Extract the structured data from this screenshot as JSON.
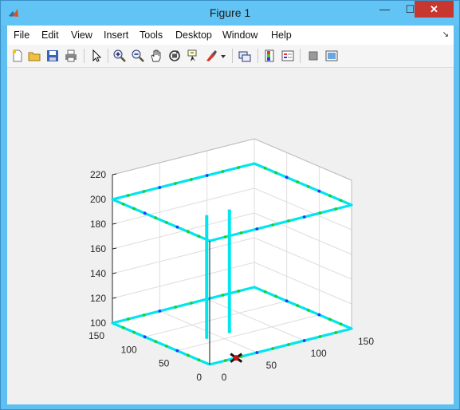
{
  "window": {
    "title": "Figure 1",
    "min_label": "—",
    "max_label": "☐",
    "close_label": "✕"
  },
  "menu": {
    "items": [
      "File",
      "Edit",
      "View",
      "Insert",
      "Tools",
      "Desktop",
      "Window",
      "Help"
    ],
    "overflow_arrow": "↘"
  },
  "toolbar": {
    "icons": [
      "new-figure-icon",
      "open-file-icon",
      "save-icon",
      "print-icon",
      "pointer-icon",
      "zoom-in-icon",
      "zoom-out-icon",
      "pan-icon",
      "rotate-3d-icon",
      "data-cursor-icon",
      "brush-icon",
      "brush-dropdown-icon",
      "link-plot-icon",
      "colorbar-icon",
      "legend-icon",
      "hide-plot-tools-icon",
      "show-plot-tools-icon"
    ]
  },
  "chart_data": {
    "type": "line3d",
    "title": "",
    "z_ticks": [
      "100",
      "120",
      "140",
      "160",
      "180",
      "200",
      "220"
    ],
    "y_ticks": [
      "0",
      "50",
      "100",
      "150"
    ],
    "x_ticks": [
      "0",
      "50",
      "100",
      "150"
    ],
    "zlim": [
      100,
      220
    ],
    "xlim": [
      0,
      150
    ],
    "ylim": [
      0,
      150
    ],
    "grid": true,
    "colors": {
      "path": "#00e5ee",
      "markers_green": "#22cc22",
      "markers_blue": "#1a3cff",
      "connector": "#111111",
      "start_marker": "#cc1111"
    },
    "series": [
      {
        "points": [
          [
            0,
            0,
            100
          ],
          [
            150,
            0,
            100
          ],
          [
            150,
            150,
            100
          ],
          [
            0,
            150,
            100
          ],
          [
            0,
            0,
            100
          ]
        ]
      },
      {
        "points": [
          [
            0,
            0,
            200
          ],
          [
            150,
            0,
            200
          ],
          [
            150,
            150,
            200
          ],
          [
            0,
            150,
            200
          ],
          [
            0,
            0,
            200
          ]
        ]
      }
    ]
  }
}
